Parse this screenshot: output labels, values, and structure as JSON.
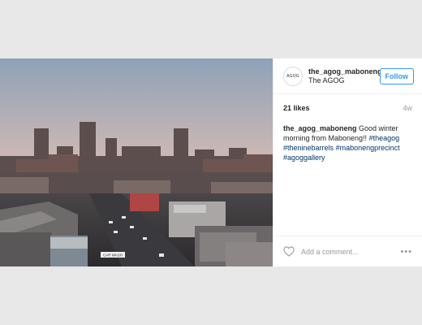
{
  "post": {
    "avatar_text": "AGOG",
    "username": "the_agog_maboneng",
    "full_name": "The AGOG",
    "follow_label": "Follow",
    "likes": "21 likes",
    "age": "4w",
    "caption_user": "the_agog_maboneng",
    "caption_text": " Good winter morning from Maboneng!! ",
    "hashtags": [
      "#theagog",
      "#theninebarrels",
      "#mabonengprecinct",
      "#agoggallery"
    ],
    "comment_placeholder": "Add a comment...",
    "more_label": "•••",
    "image_sign_text": "CAR WASH"
  },
  "colors": {
    "accent": "#3897f0",
    "hashtag": "#003569",
    "page_bg": "#e8e8e8"
  },
  "icons": {
    "like": "heart-icon",
    "more": "more-options-icon"
  }
}
